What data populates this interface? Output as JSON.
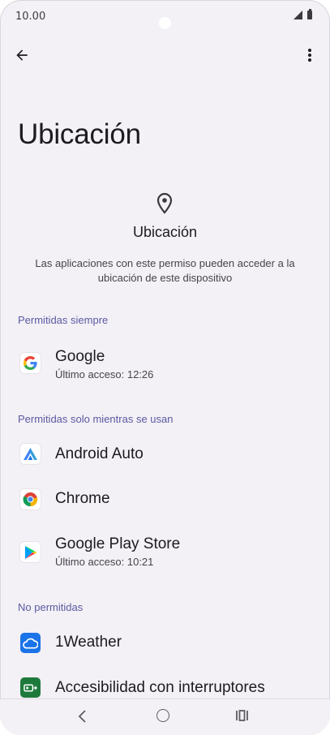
{
  "status_bar": {
    "time": "10.00"
  },
  "page": {
    "title": "Ubicación"
  },
  "header": {
    "icon": "location-pin-icon",
    "title": "Ubicación",
    "description": "Las aplicaciones con este permiso pueden acceder a la ubicación de este dispositivo"
  },
  "sections": {
    "always": "Permitidas siempre",
    "while_in_use": "Permitidas solo mientras se usan",
    "denied": "No permitidas"
  },
  "apps": {
    "google": {
      "name": "Google",
      "sub": "Último acceso: 12:26",
      "icon": "google-icon"
    },
    "android_auto": {
      "name": "Android Auto",
      "icon": "android-auto-icon"
    },
    "chrome": {
      "name": "Chrome",
      "icon": "chrome-icon"
    },
    "play_store": {
      "name": "Google Play Store",
      "sub": "Último acceso: 10:21",
      "icon": "play-store-icon"
    },
    "weather": {
      "name": "1Weather",
      "icon": "weather-icon"
    },
    "switch_access": {
      "name": "Accesibilidad con interruptores",
      "icon": "switch-access-icon"
    }
  },
  "colors": {
    "background": "#f3f0f6",
    "section_label": "#5b5aa0",
    "text_primary": "#1c1b1f"
  }
}
